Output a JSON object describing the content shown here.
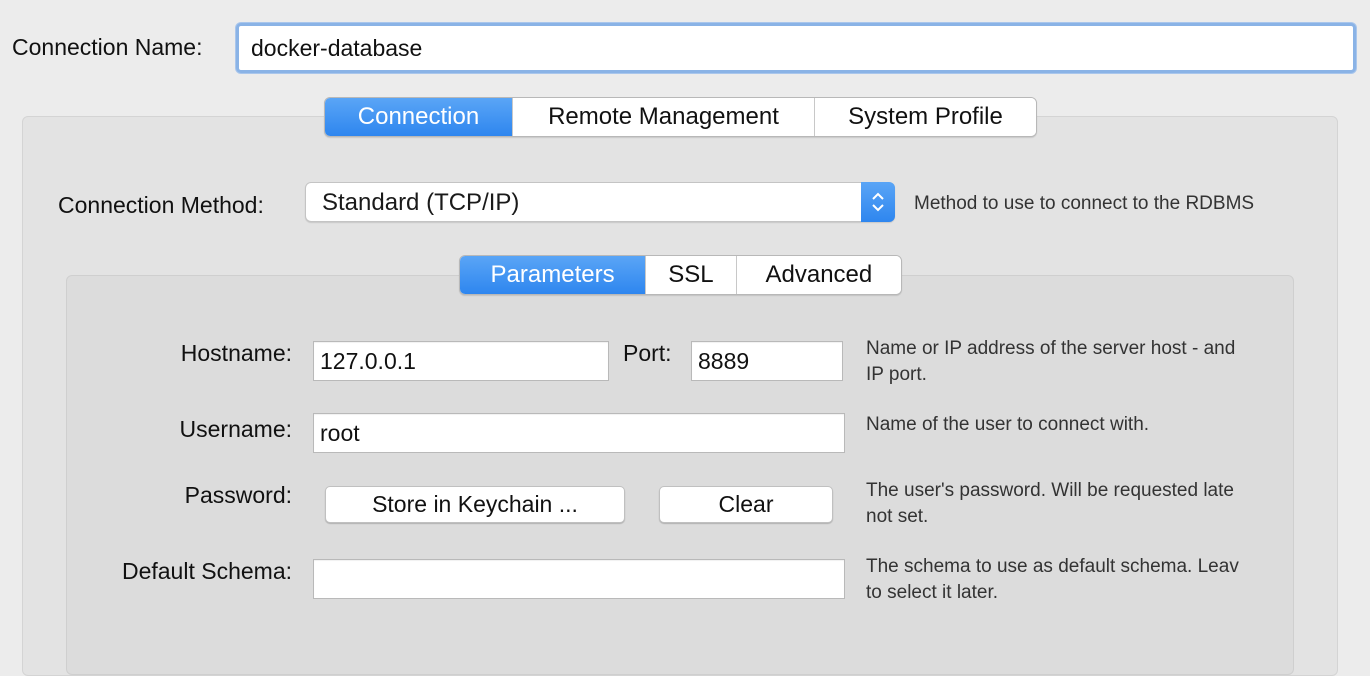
{
  "connection_name": {
    "label": "Connection Name:",
    "value": "docker-database"
  },
  "main_tabs": [
    {
      "label": "Connection",
      "active": true
    },
    {
      "label": "Remote Management",
      "active": false
    },
    {
      "label": "System Profile",
      "active": false
    }
  ],
  "connection_method": {
    "label": "Connection Method:",
    "value": "Standard (TCP/IP)",
    "description": "Method to use to connect to the RDBMS"
  },
  "sub_tabs": [
    {
      "label": "Parameters",
      "active": true
    },
    {
      "label": "SSL",
      "active": false
    },
    {
      "label": "Advanced",
      "active": false
    }
  ],
  "parameters": {
    "hostname": {
      "label": "Hostname:",
      "value": "127.0.0.1"
    },
    "port": {
      "label": "Port:",
      "value": "8889"
    },
    "hostname_desc": [
      "Name or IP address of the server host - and",
      "IP port."
    ],
    "username": {
      "label": "Username:",
      "value": "root"
    },
    "username_desc": [
      "Name of the user to connect with."
    ],
    "password": {
      "label": "Password:",
      "store_button": "Store in Keychain ...",
      "clear_button": "Clear"
    },
    "password_desc": [
      "The user's password. Will be requested late",
      "not set."
    ],
    "default_schema": {
      "label": "Default Schema:",
      "value": ""
    },
    "schema_desc": [
      "The schema to use as default schema. Leav",
      "to select it later."
    ]
  },
  "colors": {
    "accent": "#3d8ff2",
    "focus_ring": "#8ab3e6"
  }
}
